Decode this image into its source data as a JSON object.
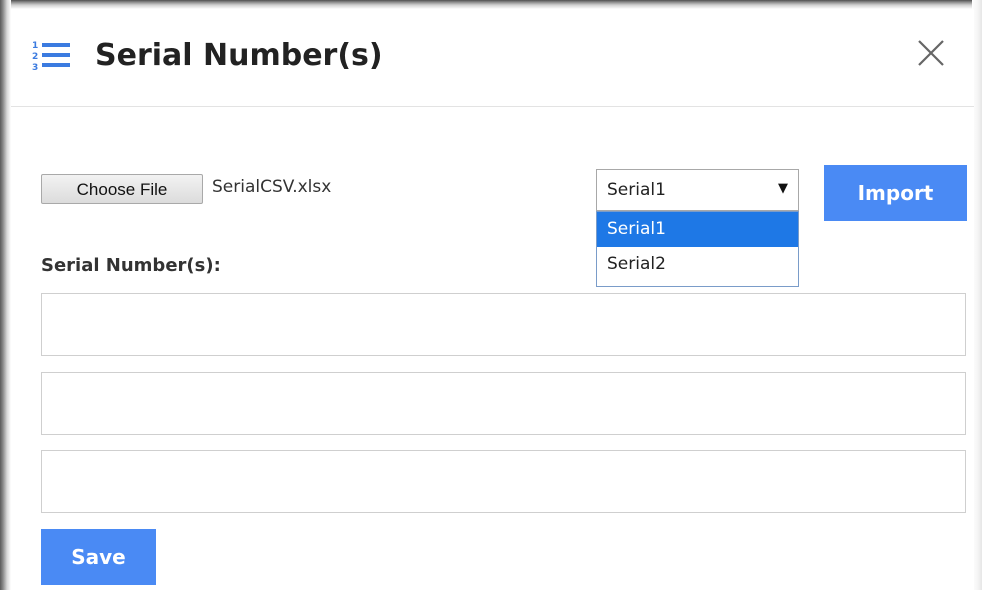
{
  "dialog": {
    "title": "Serial Number(s)",
    "icon": "numbered-list-icon",
    "close_icon": "close-icon",
    "accent_color": "#4a8af4"
  },
  "file_input": {
    "button_label": "Choose File",
    "file_name": "SerialCSV.xlsx"
  },
  "serial_select": {
    "selected_value": "Serial1",
    "options": [
      {
        "label": "Serial1",
        "selected": true
      },
      {
        "label": "Serial2",
        "selected": false
      }
    ],
    "arrow_icon": "dropdown-arrow-icon"
  },
  "import_button": {
    "label": "Import"
  },
  "serial_numbers": {
    "label": "Serial Number(s):",
    "inputs": [
      {
        "value": ""
      },
      {
        "value": ""
      },
      {
        "value": ""
      }
    ]
  },
  "save_button": {
    "label": "Save"
  }
}
